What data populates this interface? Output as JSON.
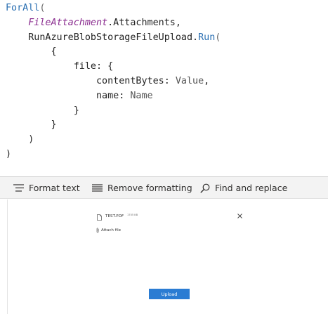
{
  "editor": {
    "formula": [
      [
        {
          "t": "ForAll",
          "c": "fn"
        },
        {
          "t": "(",
          "c": "punc"
        }
      ],
      [
        {
          "t": "    ",
          "c": "ws"
        },
        {
          "t": "FileAttachment",
          "c": "var"
        },
        {
          "t": ".Attachments,",
          "c": "ident"
        }
      ],
      [
        {
          "t": "    ",
          "c": "ws"
        },
        {
          "t": "RunAzureBlobStorageFileUpload",
          "c": "ident"
        },
        {
          "t": ".",
          "c": "ident"
        },
        {
          "t": "Run",
          "c": "fn"
        },
        {
          "t": "(",
          "c": "punc"
        }
      ],
      [
        {
          "t": "        {",
          "c": "ident"
        }
      ],
      [
        {
          "t": "            file: {",
          "c": "ident"
        }
      ],
      [
        {
          "t": "                contentBytes: ",
          "c": "prop"
        },
        {
          "t": "Value",
          "c": "val"
        },
        {
          "t": ",",
          "c": "ident"
        }
      ],
      [
        {
          "t": "                name: ",
          "c": "prop"
        },
        {
          "t": "Name",
          "c": "val"
        }
      ],
      [
        {
          "t": "            }",
          "c": "ident"
        }
      ],
      [
        {
          "t": "        }",
          "c": "ident"
        }
      ],
      [
        {
          "t": "    )",
          "c": "ident"
        }
      ],
      [
        {
          "t": ")",
          "c": "ident"
        }
      ]
    ]
  },
  "toolbar": {
    "format_text": "Format text",
    "remove_formatting": "Remove formatting",
    "find_replace": "Find and replace"
  },
  "attachment": {
    "file_name": "TEST.PDF",
    "file_size": "1705 KB",
    "attach_label": "Attach file"
  },
  "upload": {
    "label": "Upload"
  },
  "colors": {
    "function": "#2a6fb2",
    "variable": "#8a2c8f",
    "toolbar_bg": "#f3f3f3",
    "upload_button": "#2b7cd3"
  },
  "icons": {
    "format_text": "format-text-icon",
    "remove_formatting": "remove-formatting-icon",
    "find_replace": "search-icon",
    "file": "file-icon",
    "remove_file": "close-icon",
    "attach": "paperclip-icon"
  }
}
